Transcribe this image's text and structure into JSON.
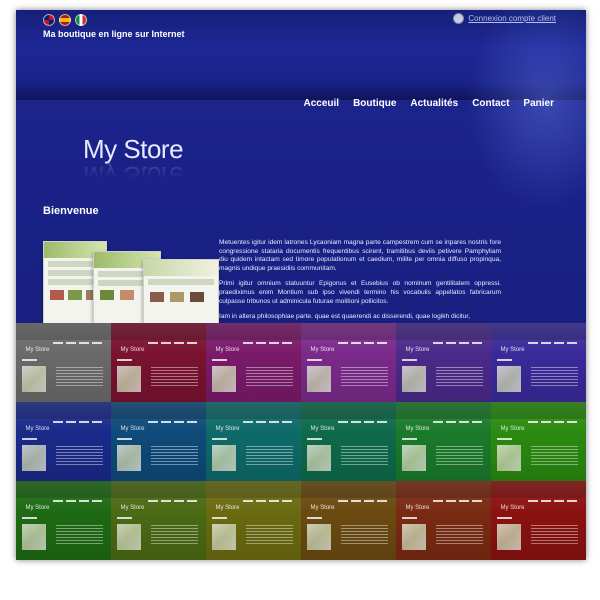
{
  "header": {
    "languages": [
      {
        "icon": "uk-flag-icon"
      },
      {
        "icon": "spain-flag-icon"
      },
      {
        "icon": "italy-flag-icon"
      }
    ],
    "tagline": "Ma boutique en ligne sur Internet",
    "account_link": "Connexion compte client",
    "account_icon": "user-icon"
  },
  "nav": {
    "items": [
      "Acceuil",
      "Boutique",
      "Actualités",
      "Contact",
      "Panier"
    ]
  },
  "logo": {
    "text": "My Store"
  },
  "main": {
    "heading": "Bienvenue",
    "paragraphs": [
      "Metuentes igitur idem latrones Lycaoniam magna parte campestrem cum se inpares nostris fore congressione stataria documentis frequentibus scirent, tramitibus deviis petivere Pamphyliam diu quidem intactam sed timore populationum et caedium, milite per omnia diffuso propinqua, magnis undique praesidiis communitam.",
      "Primi igitur omnium statuuntur Epigonus et Eusebius ob nominum gentilitatem oppressi. praediximus enim Montium sub ipso vivendi termino his vocabulis appellatos fabricarum culpasse tribunos ut adminicula futurae molitioni pollicitos.",
      "Iam in altera philosophiae parte. quae est quaerendi ac disserendi, quae logikh dicitur,"
    ]
  },
  "theme_swatches": {
    "colors": [
      "#6a6a6a",
      "#7a1230",
      "#7a1a6a",
      "#7a2a8a",
      "#4a2a8a",
      "#3a2a9a",
      "#1a2a8a",
      "#0e4a7a",
      "#0e6a6a",
      "#0e6a4a",
      "#1a7a2a",
      "#2a8a10",
      "#1e6a14",
      "#4a6a14",
      "#6a6a10",
      "#6a4a10",
      "#7a2a12",
      "#8a1210"
    ],
    "tile_logo": "My Store"
  }
}
